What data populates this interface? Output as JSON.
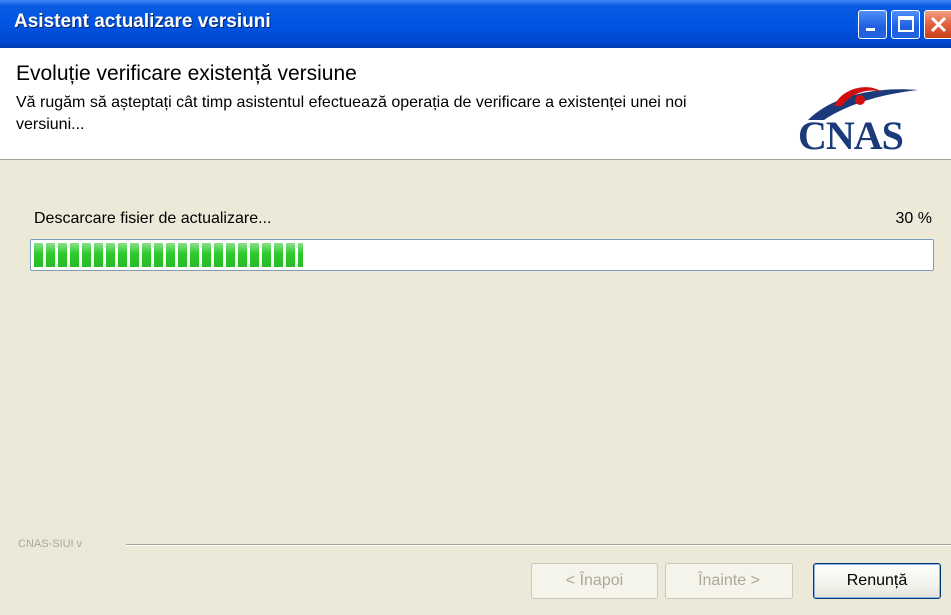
{
  "window": {
    "title": "Asistent actualizare versiuni",
    "controls": [
      "minimize-icon",
      "maximize-icon",
      "close-icon"
    ]
  },
  "header": {
    "title": "Evoluție verificare existență versiune",
    "description": "Vă rugăm să așteptați cât timp asistentul efectuează operația de verificare a existenței unei noi versiuni...",
    "logo_text": "CNAS"
  },
  "progress": {
    "status": "Descarcare fisier de actualizare...",
    "percent_label": "30 %",
    "value": 0.3
  },
  "footer": {
    "group_label": "CNAS-SIUI v",
    "back_label": "< Înapoi",
    "next_label": "Înainte >",
    "cancel_label": "Renunță"
  },
  "colors": {
    "titlebar": "#0054e3",
    "progress_fill": "#2cc92c",
    "logo_blue": "#1a3a7a",
    "logo_red": "#d01010"
  }
}
